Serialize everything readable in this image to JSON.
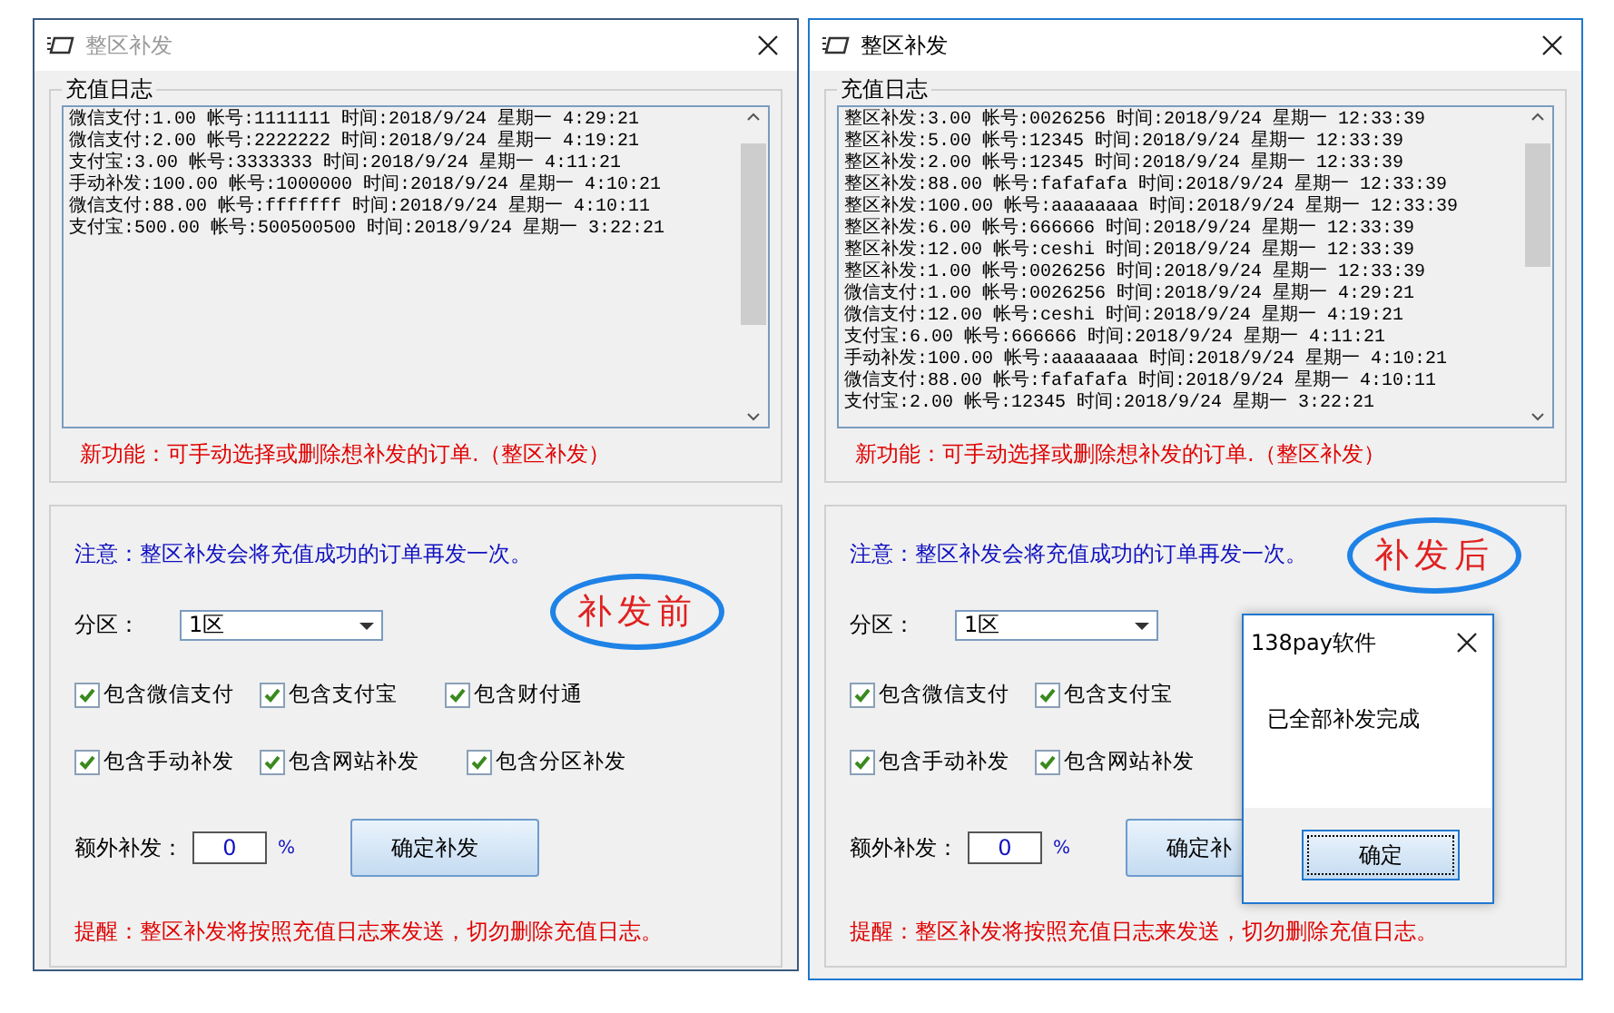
{
  "windows": [
    {
      "title": "整区补发",
      "active": false,
      "log_group": "充值日志",
      "log_lines": [
        "微信支付:1.00 帐号:1111111 时间:2018/9/24 星期一 4:29:21",
        "微信支付:2.00 帐号:2222222 时间:2018/9/24 星期一 4:19:21",
        "支付宝:3.00 帐号:3333333 时间:2018/9/24 星期一 4:11:21",
        "手动补发:100.00 帐号:1000000 时间:2018/9/24 星期一 4:10:21",
        "微信支付:88.00 帐号:fffffff 时间:2018/9/24 星期一 4:10:11",
        "支付宝:500.00 帐号:500500500 时间:2018/9/24 星期一 3:22:21"
      ],
      "feature_note": "新功能：可手动选择或删除想补发的订单.（整区补发）",
      "notice": "注意：整区补发会将充值成功的订单再发一次。",
      "partition_label": "分区：",
      "partition_value": "1区",
      "checkbox_rows": [
        [
          {
            "label": "包含微信支付",
            "checked": true
          },
          {
            "label": "包含支付宝",
            "checked": true
          },
          {
            "label": "包含财付通",
            "checked": true
          }
        ],
        [
          {
            "label": "包含手动补发",
            "checked": true
          },
          {
            "label": "包含网站补发",
            "checked": true
          },
          {
            "label": "包含分区补发",
            "checked": true
          }
        ]
      ],
      "extra_label": "额外补发：",
      "extra_value": "0",
      "percent": "%",
      "confirm_button": "确定补发",
      "reminder": "提醒：整区补发将按照充值日志来发送，切勿删除充值日志。",
      "annotation": "补发前"
    },
    {
      "title": "整区补发",
      "active": true,
      "log_group": "充值日志",
      "log_lines": [
        "整区补发:3.00 帐号:0026256 时间:2018/9/24 星期一 12:33:39",
        "整区补发:5.00 帐号:12345 时间:2018/9/24 星期一 12:33:39",
        "整区补发:2.00 帐号:12345 时间:2018/9/24 星期一 12:33:39",
        "整区补发:88.00 帐号:fafafafa 时间:2018/9/24 星期一 12:33:39",
        "整区补发:100.00 帐号:aaaaaaaa 时间:2018/9/24 星期一 12:33:39",
        "整区补发:6.00 帐号:666666 时间:2018/9/24 星期一 12:33:39",
        "整区补发:12.00 帐号:ceshi 时间:2018/9/24 星期一 12:33:39",
        "整区补发:1.00 帐号:0026256 时间:2018/9/24 星期一 12:33:39",
        "微信支付:1.00 帐号:0026256 时间:2018/9/24 星期一 4:29:21",
        "微信支付:12.00 帐号:ceshi 时间:2018/9/24 星期一 4:19:21",
        "支付宝:6.00 帐号:666666 时间:2018/9/24 星期一 4:11:21",
        "手动补发:100.00 帐号:aaaaaaaa 时间:2018/9/24 星期一 4:10:21",
        "微信支付:88.00 帐号:fafafafa 时间:2018/9/24 星期一 4:10:11",
        "支付宝:2.00 帐号:12345 时间:2018/9/24 星期一 3:22:21"
      ],
      "feature_note": "新功能：可手动选择或删除想补发的订单.（整区补发）",
      "notice": "注意：整区补发会将充值成功的订单再发一次。",
      "partition_label": "分区：",
      "partition_value": "1区",
      "checkbox_rows": [
        [
          {
            "label": "包含微信支付",
            "checked": true
          },
          {
            "label": "包含支付宝",
            "checked": true
          }
        ],
        [
          {
            "label": "包含手动补发",
            "checked": true
          },
          {
            "label": "包含网站补发",
            "checked": true
          }
        ]
      ],
      "extra_label": "额外补发：",
      "extra_value": "0",
      "percent": "%",
      "confirm_button": "确定补",
      "reminder": "提醒：整区补发将按照充值日志来发送，切勿删除充值日志。",
      "annotation": "补发后"
    }
  ],
  "dialog": {
    "title": "138pay软件",
    "message": "已全部补发完成",
    "ok_button": "确定"
  }
}
